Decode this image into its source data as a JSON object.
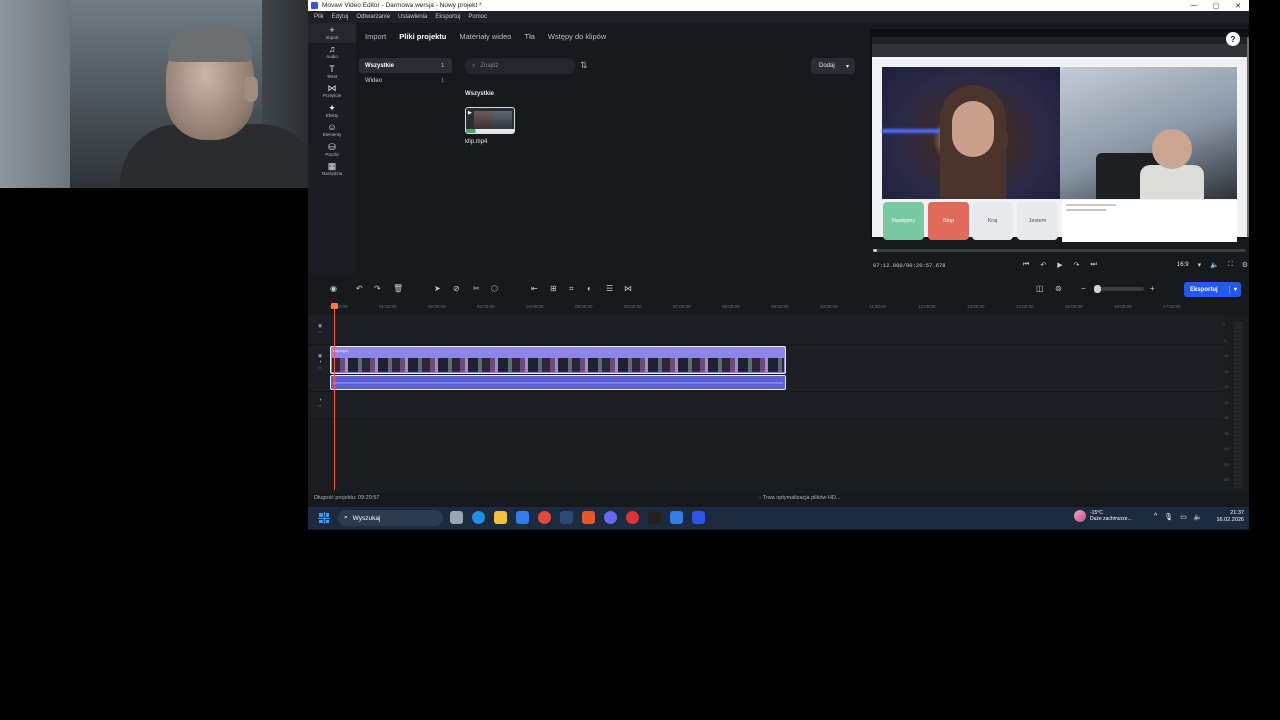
{
  "window": {
    "title": "Movavi Video Editor - Darmowa wersja - Nowy projekt *",
    "controls": [
      "—",
      "▢",
      "✕"
    ]
  },
  "menu": [
    "Plik",
    "Edytuj",
    "Odtwarzanie",
    "Ustawienia",
    "Eksportuj",
    "Pomoc"
  ],
  "sidebar": {
    "items": [
      {
        "label": "Import",
        "icon": "plus-icon",
        "glyph": "+"
      },
      {
        "label": "Audio",
        "icon": "music-note-icon",
        "glyph": "♫"
      },
      {
        "label": "Tekst",
        "icon": "text-icon",
        "glyph": "T"
      },
      {
        "label": "Przejście",
        "icon": "transition-icon",
        "glyph": "⋈"
      },
      {
        "label": "Efekty",
        "icon": "effects-icon",
        "glyph": "✦"
      },
      {
        "label": "Elementy",
        "icon": "elements-icon",
        "glyph": "☺"
      },
      {
        "label": "Paczki",
        "icon": "bag-icon",
        "glyph": "⛁"
      },
      {
        "label": "Narzędzia",
        "icon": "tools-icon",
        "glyph": "▦"
      }
    ]
  },
  "tabs": [
    "Import",
    "Pliki projektu",
    "Materiały wideo",
    "Tła",
    "Wstępy do klipów"
  ],
  "active_tab": 1,
  "categories": [
    {
      "label": "Wszystkie",
      "count": "1"
    },
    {
      "label": "Wideo",
      "count": "1"
    }
  ],
  "search": {
    "placeholder": "Znajdź"
  },
  "add_button": {
    "label": "Dodaj"
  },
  "media": {
    "group_label": "Wszystkie",
    "items": [
      {
        "name": "klip.mp4"
      }
    ]
  },
  "preview": {
    "buttons": [
      "Następny",
      "Stop",
      "Kraj",
      "Jestem"
    ],
    "timecode": "07:12.000/00:20:57.678",
    "progress": 0.011,
    "aspect_ratio": "16:9",
    "help": "?"
  },
  "timeline": {
    "export_label": "Eksportuj",
    "ruler": [
      "00:00:00",
      "01:00:00",
      "02:00:00",
      "03:00:00",
      "04:00:00",
      "05:00:00",
      "06:00:00",
      "07:00:00",
      "08:00:00",
      "09:00:00",
      "10:00:00",
      "11:00:00",
      "12:00:00",
      "13:00:00",
      "14:00:00",
      "15:00:00",
      "16:00:00",
      "17:00:00"
    ],
    "clip_name": "klip.mp4",
    "vu_scale": [
      "0",
      "-5",
      "-10",
      "-15",
      "-20",
      "-25",
      "-30",
      "-35",
      "-40",
      "-50",
      "-60"
    ]
  },
  "status": {
    "project_length": "Długość projektu: 09:20:57",
    "optimizing": "Trwa optymalizacja plików HD..."
  },
  "taskbar": {
    "search_label": "Wyszukaj",
    "weather_temp": "-15°C",
    "weather_desc": "Duże zachmurze...",
    "time": "21:37",
    "date": "16.02.2026"
  },
  "colors": {
    "accent": "#2359f0",
    "clip_video": "#8b86e8",
    "clip_audio": "#5a5fd1",
    "playhead": "#ff5a3c"
  }
}
